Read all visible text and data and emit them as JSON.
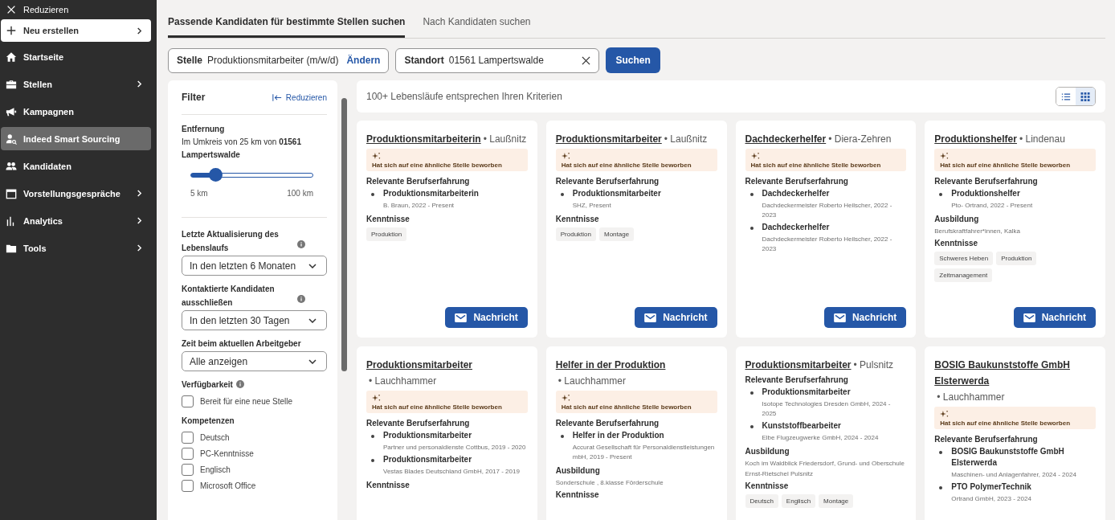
{
  "sidebar": {
    "collapse_label": "Reduzieren",
    "create_button": "Neu erstellen",
    "items": [
      {
        "label": "Startseite",
        "kind": "home",
        "selected": false,
        "has_submenu": false
      },
      {
        "label": "Stellen",
        "kind": "briefcase",
        "selected": false,
        "has_submenu": true
      },
      {
        "label": "Kampagnen",
        "kind": "megaphone",
        "selected": false,
        "has_submenu": false
      },
      {
        "label": "Indeed Smart Sourcing",
        "kind": "person-search",
        "selected": true,
        "has_submenu": false
      },
      {
        "label": "Kandidaten",
        "kind": "people",
        "selected": false,
        "has_submenu": false
      },
      {
        "label": "Vorstellungsgespräche",
        "kind": "calendar",
        "selected": false,
        "has_submenu": true
      },
      {
        "label": "Analytics",
        "kind": "chart",
        "selected": false,
        "has_submenu": true
      },
      {
        "label": "Tools",
        "kind": "folder",
        "selected": false,
        "has_submenu": true
      }
    ]
  },
  "tabs": [
    {
      "label": "Passende Kandidaten für bestimmte Stellen suchen",
      "selected": true
    },
    {
      "label": "Nach Kandidaten suchen",
      "selected": false
    }
  ],
  "search": {
    "job_label": "Stelle",
    "job_value": "Produktionsmitarbeiter (m/w/d)",
    "change_link": "Ändern",
    "location_label": "Standort",
    "location_value": "01561 Lampertswalde",
    "submit": "Suchen"
  },
  "filter": {
    "title": "Filter",
    "collapse_label": "Reduzieren",
    "distance": {
      "heading": "Entfernung",
      "description": "Im Umkreis von 25 km von **01561 Lampertswalde**",
      "level": 0.2,
      "min_label": "5 km",
      "max_label": "100 km"
    },
    "dropdowns": [
      {
        "label": "Letzte Aktualisierung des Lebenslaufs",
        "info": true,
        "value": "In den letzten 6 Monaten"
      },
      {
        "label": "Kontaktierte Kandidaten ausschließen",
        "info": true,
        "value": "In den letzten 30 Tagen"
      },
      {
        "label": "Zeit beim aktuellen Arbeitgeber",
        "info": false,
        "value": "Alle anzeigen"
      }
    ],
    "groups": [
      {
        "heading": "Verfügbarkeit",
        "info": true,
        "options": [
          {
            "label": "Bereit für eine neue Stelle",
            "checked": false
          }
        ]
      },
      {
        "heading": "Kompetenzen",
        "info": false,
        "options": [
          {
            "label": "Deutsch",
            "checked": false
          },
          {
            "label": "PC-Kenntnisse",
            "checked": false
          },
          {
            "label": "Englisch",
            "checked": false
          },
          {
            "label": "Microsoft Office",
            "checked": false
          }
        ]
      }
    ]
  },
  "results": {
    "summary": "100+ Lebensläufe entsprechen Ihren Kriterien",
    "views": [
      {
        "kind": "list",
        "selected": false
      },
      {
        "kind": "grid",
        "selected": true
      }
    ],
    "cards": [
      {
        "title": "Produktionsmitarbeiterin",
        "location": "• Laußnitz",
        "badge": "Hat sich auf eine ähnliche Stelle beworben",
        "button": "Nachricht",
        "sections": [
          {
            "kind": "experience",
            "heading": "Relevante Berufserfahrung",
            "entries": [
              {
                "title": "Produktionsmitarbeiterin",
                "detail": "B. Braun, 2022 - Present"
              }
            ]
          },
          {
            "kind": "skills",
            "heading": "Kenntnisse",
            "tags": [
              "Produktion"
            ]
          }
        ]
      },
      {
        "title": "Produktionsmitarbeiter",
        "location": "• Laußnitz",
        "badge": "Hat sich auf eine ähnliche Stelle beworben",
        "button": "Nachricht",
        "sections": [
          {
            "kind": "experience",
            "heading": "Relevante Berufserfahrung",
            "entries": [
              {
                "title": "Produktionsmitarbeiter",
                "detail": "SHZ, Present"
              }
            ]
          },
          {
            "kind": "skills",
            "heading": "Kenntnisse",
            "tags": [
              "Produktion",
              "Montage"
            ]
          }
        ]
      },
      {
        "title": "Dachdeckerhelfer",
        "location": "• Diera-Zehren",
        "badge": "Hat sich auf eine ähnliche Stelle beworben",
        "button": "Nachricht",
        "sections": [
          {
            "kind": "experience",
            "heading": "Relevante Berufserfahrung",
            "entries": [
              {
                "title": "Dachdeckerhelfer",
                "detail": "Dachdeckermeister Roberto Heilscher, 2022 - 2023"
              },
              {
                "title": "Dachdeckerhelfer",
                "detail": "Dachdeckermeister Roberto Heilscher, 2022 - 2023"
              }
            ]
          }
        ]
      },
      {
        "title": "Produktionshelfer",
        "location": "• Lindenau",
        "badge": "Hat sich auf eine ähnliche Stelle beworben",
        "button": "Nachricht",
        "sections": [
          {
            "kind": "experience",
            "heading": "Relevante Berufserfahrung",
            "entries": [
              {
                "title": "Produktionshelfer",
                "detail": "Pto- Ortrand, 2022 - Present"
              }
            ]
          },
          {
            "kind": "education",
            "heading": "Ausbildung",
            "text": "Berufskraftfahrer*innen, Kalka"
          },
          {
            "kind": "skills",
            "heading": "Kenntnisse",
            "tags": [
              "Schweres Heben",
              "Produktion",
              "Zeitmanagement"
            ]
          }
        ]
      },
      {
        "title": "Produktionsmitarbeiter",
        "location": "• Lauchhammer",
        "badge": "Hat sich auf eine ähnliche Stelle beworben",
        "sections": [
          {
            "kind": "experience",
            "heading": "Relevante Berufserfahrung",
            "entries": [
              {
                "title": "Produktionsmitarbeiter",
                "detail": "Partner und personaldienste Cottbus, 2019 - 2020"
              },
              {
                "title": "Produktionsmitarbeiter",
                "detail": "Vestas Blades Deutschland GmbH, 2017 - 2019"
              }
            ]
          },
          {
            "kind": "skills",
            "heading": "Kenntnisse"
          }
        ]
      },
      {
        "title": "Helfer in der Produktion",
        "location": "• Lauchhammer",
        "badge": "Hat sich auf eine ähnliche Stelle beworben",
        "sections": [
          {
            "kind": "experience",
            "heading": "Relevante Berufserfahrung",
            "entries": [
              {
                "title": "Helfer in der Produktion",
                "detail": "Accurat Gesellschaft für Personaldienstleistungen mbH, 2019 - Present"
              }
            ]
          },
          {
            "kind": "education",
            "heading": "Ausbildung",
            "text": "Sonderschule , 8.klasse Förderschule"
          },
          {
            "kind": "skills",
            "heading": "Kenntnisse"
          }
        ]
      },
      {
        "title": "Produktionsmitarbeiter",
        "location": "• Pulsnitz",
        "sections": [
          {
            "kind": "experience",
            "heading": "Relevante Berufserfahrung",
            "entries": [
              {
                "title": "Produktionsmitarbeiter",
                "detail": "Isotope Technologies Dresden GmbH, 2024 - 2025"
              },
              {
                "title": "Kunststoffbearbeiter",
                "detail": "Elbe Flugzeugwerke GmbH, 2024 - 2024"
              }
            ]
          },
          {
            "kind": "education",
            "heading": "Ausbildung",
            "text": "Koch im Waldblick Friedersdorf, Grund- und Oberschule Ernst-Rietschel Pulsnitz"
          },
          {
            "kind": "skills",
            "heading": "Kenntnisse",
            "tags": [
              "Deutsch",
              "Englisch",
              "Montage"
            ]
          }
        ]
      },
      {
        "title": "BOSIG Baukunststoffe GmbH Elsterwerda",
        "location": "• Lauchhammer",
        "badge": "Hat sich auf eine ähnliche Stelle beworben",
        "sections": [
          {
            "kind": "experience",
            "heading": "Relevante Berufserfahrung",
            "entries": [
              {
                "title": "BOSIG Baukunststoffe GmbH Elsterwerda",
                "detail": "Maschinen- und Anlagenfahrer, 2024 - 2024"
              },
              {
                "title": "PTO PolymerTechnik",
                "detail": "Ortrand GmbH, 2023 - 2024"
              }
            ]
          }
        ]
      }
    ]
  }
}
